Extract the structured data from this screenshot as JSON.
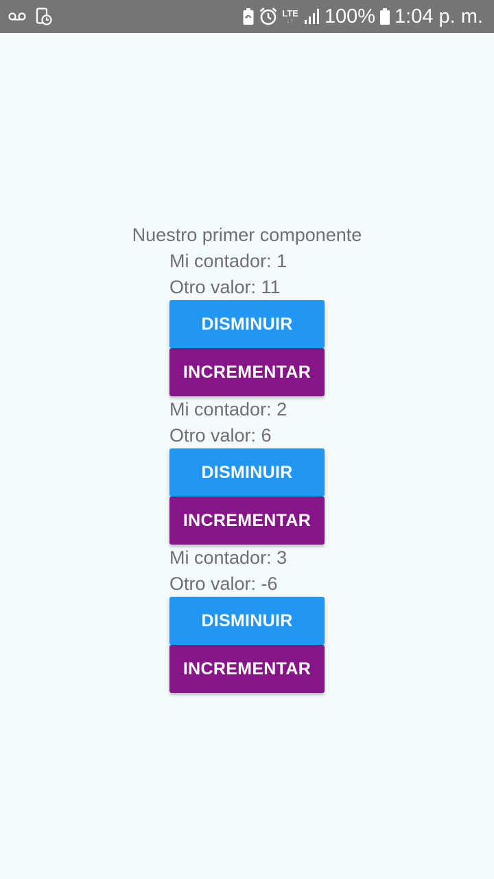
{
  "status_bar": {
    "battery_percent": "100%",
    "time": "1:04 p. m.",
    "network": "LTE",
    "icons": [
      "voicemail-icon",
      "screen-record-icon",
      "battery-saver-icon",
      "alarm-icon",
      "lte-icon",
      "signal-icon",
      "battery-icon"
    ]
  },
  "main": {
    "title": "Nuestro primer componente",
    "counters": [
      {
        "contador": "Mi contador: 1",
        "valor": "Otro valor: 11",
        "decrease_label": "DISMINUIR",
        "increase_label": "INCREMENTAR"
      },
      {
        "contador": "Mi contador: 2",
        "valor": "Otro valor: 6",
        "decrease_label": "DISMINUIR",
        "increase_label": "INCREMENTAR"
      },
      {
        "contador": "Mi contador: 3",
        "valor": "Otro valor: -6",
        "decrease_label": "DISMINUIR",
        "increase_label": "INCREMENTAR"
      }
    ]
  },
  "colors": {
    "status_bar": "#757575",
    "background": "#f4fbff",
    "decrease_button": "#2196f3",
    "increase_button": "#861687",
    "text": "#6f6f6f"
  }
}
